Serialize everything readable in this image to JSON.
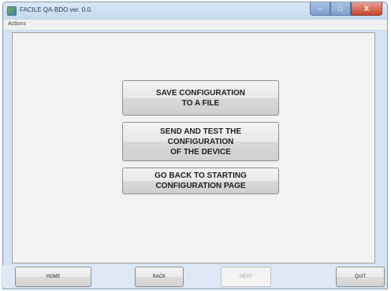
{
  "window": {
    "title": "FACILE QA-BDO ver. 0.0.",
    "controls": {
      "minimize": "–",
      "maximize": "□",
      "close": "X"
    }
  },
  "menu": {
    "items": [
      "Actions"
    ]
  },
  "actions": {
    "save_config": "SAVE CONFIGURATION\nTO A FILE",
    "send_test": "SEND AND TEST THE\nCONFIGURATION\nOF THE DEVICE",
    "go_back": "GO BACK TO STARTING\nCONFIGURATION PAGE"
  },
  "navigation": {
    "home": "HOME",
    "back": "BACK",
    "next": "NEXT",
    "quit": "QUIT",
    "next_enabled": false
  },
  "colors": {
    "window_frame": "#d3e3f3",
    "content_bg": "#f2f2f2",
    "close_button": "#c7442f"
  }
}
